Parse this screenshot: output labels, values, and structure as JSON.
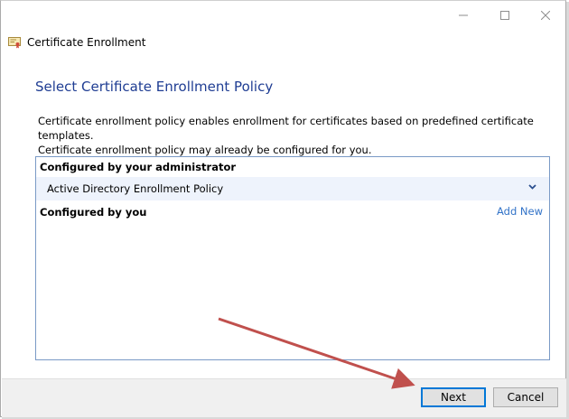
{
  "window": {
    "title": "Certificate Enrollment",
    "title_icon": "certificate-icon",
    "caption_buttons": [
      "minimize-icon",
      "maximize-icon",
      "close-icon"
    ]
  },
  "page": {
    "heading": "Select Certificate Enrollment Policy",
    "description_line1": "Certificate enrollment policy enables enrollment for certificates based on predefined certificate templates.",
    "description_line2": "Certificate enrollment policy may already be configured for you."
  },
  "panel": {
    "admin_section_label": "Configured by your administrator",
    "admin_policy": "Active Directory Enrollment Policy",
    "user_section_label": "Configured by you",
    "add_new_link": "Add New"
  },
  "footer": {
    "next_label": "Next",
    "cancel_label": "Cancel"
  },
  "colors": {
    "heading": "#1f3d93",
    "link": "#3273c8",
    "panel_border": "#7a9ac6",
    "selected_row": "#eef3fc",
    "annotation_arrow": "#c0504d"
  }
}
